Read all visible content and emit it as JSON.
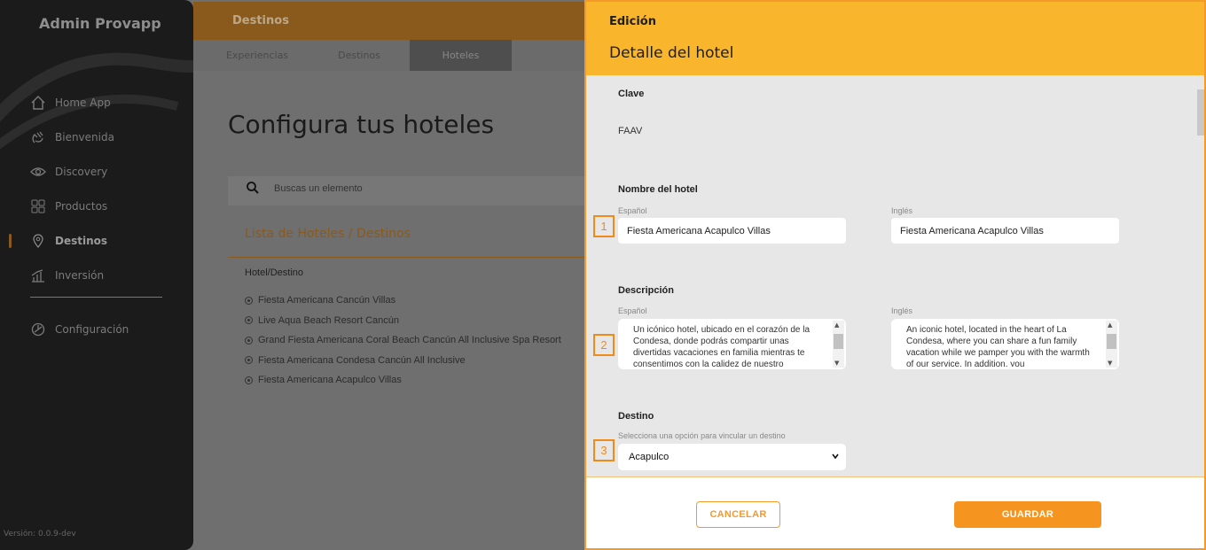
{
  "sidebar": {
    "brand": "Admin Provapp",
    "items": [
      {
        "label": "Home App",
        "icon": "home-icon"
      },
      {
        "label": "Bienvenida",
        "icon": "hand-wave-icon"
      },
      {
        "label": "Discovery",
        "icon": "eye-icon"
      },
      {
        "label": "Productos",
        "icon": "grid-icon"
      },
      {
        "label": "Destinos",
        "icon": "location-pin-icon",
        "active": true
      },
      {
        "label": "Inversión",
        "icon": "bar-chart-icon"
      }
    ],
    "config": {
      "label": "Configuración",
      "icon": "settings-icon"
    },
    "version": "Versión: 0.0.9-dev"
  },
  "main": {
    "header": "Destinos",
    "tabs": [
      "Experiencias",
      "Destinos",
      "Hoteles"
    ],
    "selected_tab": "Hoteles",
    "page_title": "Configura tus hoteles",
    "search_placeholder": "Buscas un elemento",
    "list_title": "Lista de Hoteles / Destinos",
    "column_header": "Hotel/Destino",
    "hotels": [
      "Fiesta Americana Cancún Villas",
      "Live Aqua Beach Resort Cancún",
      "Grand Fiesta Americana Coral Beach Cancún All Inclusive Spa Resort",
      "Fiesta Americana Condesa Cancún All Inclusive",
      "Fiesta Americana Acapulco Villas"
    ]
  },
  "panel": {
    "kicker": "Edición",
    "title": "Detalle del hotel",
    "clave_label": "Clave",
    "clave_value": "FAAV",
    "nombre_label": "Nombre del hotel",
    "lang_es": "Español",
    "lang_en": "Inglés",
    "nombre_es": "Fiesta Americana Acapulco Villas",
    "nombre_en": "Fiesta Americana Acapulco Villas",
    "descripcion_label": "Descripción",
    "descripcion_es": "Un icónico hotel, ubicado en el corazón de la Condesa, donde podrás compartir unas divertidas vacaciones en familia mientras te consentimos con la calidez de nuestro",
    "descripcion_en": "An iconic hotel, located in the heart of La Condesa, where you can share a fun family vacation while we pamper you with the warmth of our service. In addition, you",
    "destino_label": "Destino",
    "destino_hint": "Selecciona una opción para vincular un destino",
    "destino_value": "Acapulco",
    "badges": [
      "1",
      "2",
      "3"
    ],
    "cancel_label": "CANCELAR",
    "save_label": "GUARDAR"
  },
  "colors": {
    "accent": "#f9b52b",
    "button": "#f5941f",
    "border": "#f39a2b"
  }
}
